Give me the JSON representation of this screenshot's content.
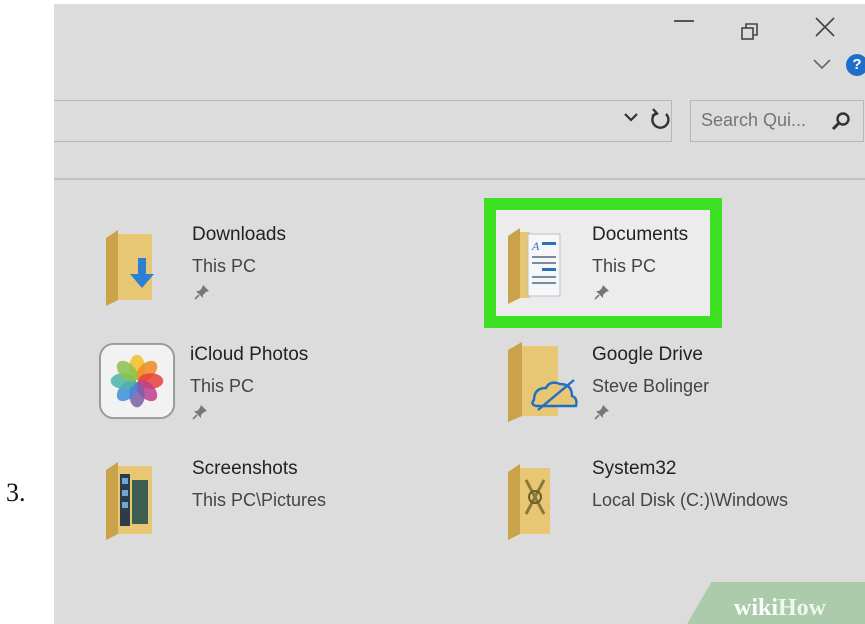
{
  "step": {
    "number": "3."
  },
  "titlebar": {
    "minimize_icon": "minimize-icon",
    "restore_icon": "restore-icon",
    "close_icon": "close-icon"
  },
  "ribbon": {
    "help_label": "?"
  },
  "search": {
    "placeholder": "Search Qui..."
  },
  "quick_access": [
    {
      "name": "Downloads",
      "location": "This PC",
      "pinned": true,
      "icon": "downloads-folder-icon"
    },
    {
      "name": "Documents",
      "location": "This PC",
      "pinned": true,
      "icon": "documents-folder-icon",
      "highlighted": true
    },
    {
      "name": "iCloud Photos",
      "location": "This PC",
      "pinned": true,
      "icon": "icloud-photos-icon"
    },
    {
      "name": "Google Drive",
      "location": "Steve Bolinger",
      "pinned": true,
      "icon": "google-drive-folder-icon"
    },
    {
      "name": "Screenshots",
      "location": "This PC\\Pictures",
      "pinned": false,
      "icon": "screenshots-folder-icon"
    },
    {
      "name": "System32",
      "location": "Local Disk (C:)\\Windows",
      "pinned": false,
      "icon": "system32-folder-icon"
    }
  ],
  "colors": {
    "highlight": "#3ee023",
    "background": "#dcdcdc",
    "help_blue": "#1f6fc9"
  },
  "watermark": {
    "part1": "wiki",
    "part2": "How"
  }
}
